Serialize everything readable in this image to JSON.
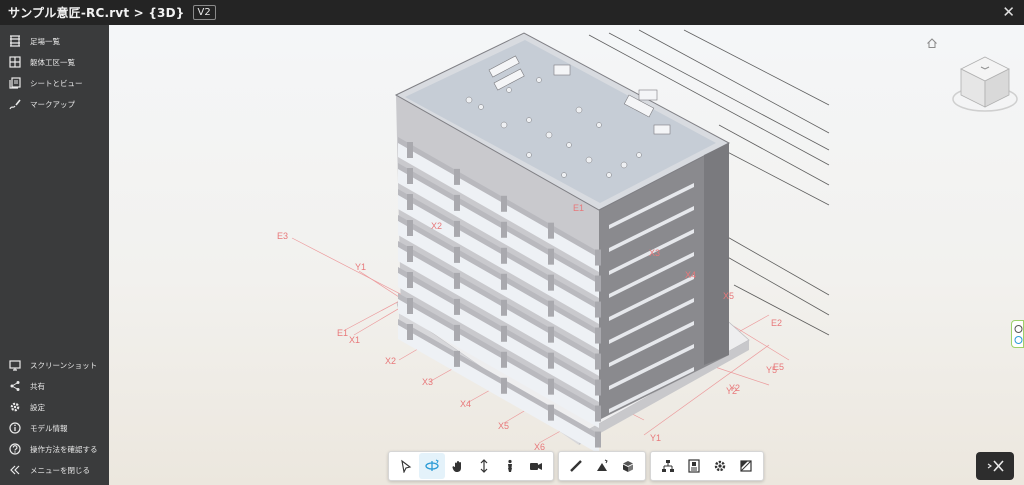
{
  "window": {
    "title": "サンプル意匠-RC.rvt > {3D}",
    "version_badge": "V2",
    "close_icon": "close-icon"
  },
  "sidebar": {
    "top_items": [
      {
        "label": "足場一覧",
        "icon": "levels-icon"
      },
      {
        "label": "躯体工区一覧",
        "icon": "grid-icon"
      },
      {
        "label": "シートとビュー",
        "icon": "sheets-icon"
      },
      {
        "label": "マークアップ",
        "icon": "markup-icon"
      }
    ],
    "bottom_items": [
      {
        "label": "スクリーンショット",
        "icon": "screenshot-icon"
      },
      {
        "label": "共有",
        "icon": "share-icon"
      },
      {
        "label": "設定",
        "icon": "gear-icon"
      },
      {
        "label": "モデル情報",
        "icon": "info-icon"
      },
      {
        "label": "操作方法を確認する",
        "icon": "help-icon"
      },
      {
        "label": "メニューを閉じる",
        "icon": "collapse-icon"
      }
    ]
  },
  "grid_labels": [
    "E3",
    "Y1",
    "E1",
    "X1",
    "X2",
    "X3",
    "X4",
    "X5",
    "X6",
    "Y1",
    "Y2",
    "X5",
    "X3",
    "X4",
    "E2",
    "E5",
    "Y5",
    "Y2",
    "X2",
    "E1"
  ],
  "viewport": {
    "home_icon": "home-icon",
    "viewcube_icon": "viewcube-icon"
  },
  "toolbar": {
    "groups": [
      [
        "select-icon",
        "orbit-icon",
        "pan-icon",
        "zoom-icon",
        "walk-icon",
        "camera-icon"
      ],
      [
        "measure-icon",
        "section-icon",
        "explode-icon"
      ],
      [
        "model-browser-icon",
        "properties-icon",
        "settings-icon",
        "fullscreen-icon"
      ]
    ],
    "active": "orbit-icon"
  },
  "tools_button_icon": "tools-icon",
  "colors": {
    "titlebar": "#242424",
    "sidebar": "#3a3b3c",
    "grid_line": "#e8787a",
    "accent": "#2b9bd6"
  }
}
